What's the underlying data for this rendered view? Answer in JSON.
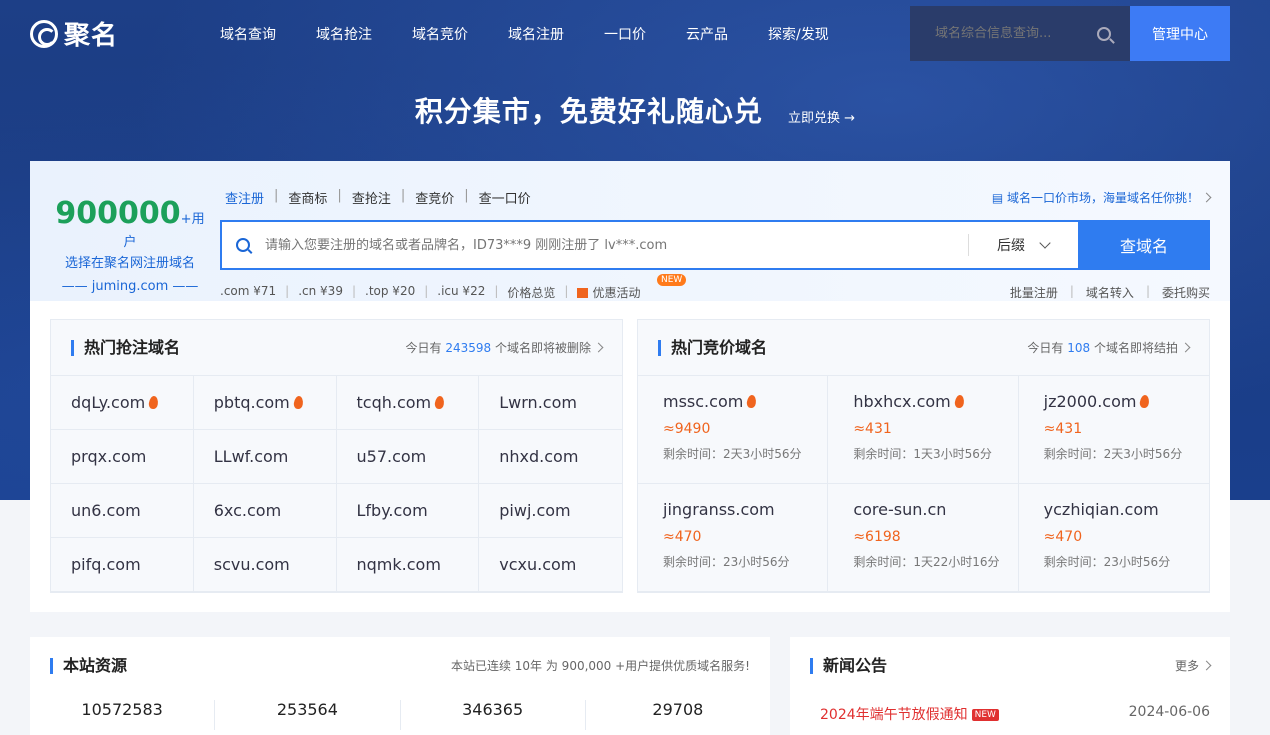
{
  "header": {
    "logo_text": "聚名",
    "nav": [
      "域名查询",
      "域名抢注",
      "域名竞价",
      "域名注册",
      "一口价",
      "云产品",
      "探索/发现"
    ],
    "search_placeholder": "域名综合信息查询...",
    "admin_label": "管理中心"
  },
  "banner": {
    "title": "积分集市，免费好礼随心兑",
    "link": "立即兑换 →"
  },
  "promo": {
    "number": "900000",
    "suffix": "+用户",
    "line2": "选择在聚名网注册域名",
    "line3": "—— juming.com ——"
  },
  "search": {
    "tabs": [
      "查注册",
      "查商标",
      "查抢注",
      "查竞价",
      "查一口价"
    ],
    "market_link": "域名一口价市场，海量域名任你挑！",
    "placeholder": "请输入您要注册的域名或者品牌名，ID73***9 刚刚注册了 lv***.com",
    "suffix_label": "后缀",
    "button": "查域名",
    "prices": [
      ".com ¥71",
      ".cn ¥39",
      ".top ¥20",
      ".icu ¥22",
      "价格总览"
    ],
    "promo_label": "优惠活动",
    "new_badge": "NEW",
    "actions": [
      "批量注册",
      "域名转入",
      "委托购买"
    ]
  },
  "hot_snatch": {
    "title": "热门抢注域名",
    "meta_prefix": "今日有",
    "meta_count": "243598",
    "meta_suffix": "个域名即将被删除",
    "domains": [
      {
        "name": "dqLy.com",
        "hot": true
      },
      {
        "name": "pbtq.com",
        "hot": true
      },
      {
        "name": "tcqh.com",
        "hot": true
      },
      {
        "name": "Lwrn.com",
        "hot": false
      },
      {
        "name": "prqx.com",
        "hot": false
      },
      {
        "name": "LLwf.com",
        "hot": false
      },
      {
        "name": "u57.com",
        "hot": false
      },
      {
        "name": "nhxd.com",
        "hot": false
      },
      {
        "name": "un6.com",
        "hot": false
      },
      {
        "name": "6xc.com",
        "hot": false
      },
      {
        "name": "Lfby.com",
        "hot": false
      },
      {
        "name": "piwj.com",
        "hot": false
      },
      {
        "name": "pifq.com",
        "hot": false
      },
      {
        "name": "scvu.com",
        "hot": false
      },
      {
        "name": "nqmk.com",
        "hot": false
      },
      {
        "name": "vcxu.com",
        "hot": false
      }
    ]
  },
  "hot_auction": {
    "title": "热门竞价域名",
    "meta_prefix": "今日有",
    "meta_count": "108",
    "meta_suffix": "个域名即将结拍",
    "items": [
      {
        "name": "mssc.com",
        "price": "≈9490",
        "time": "剩余时间：2天3小时56分",
        "hot": true
      },
      {
        "name": "hbxhcx.com",
        "price": "≈431",
        "time": "剩余时间：1天3小时56分",
        "hot": true
      },
      {
        "name": "jz2000.com",
        "price": "≈431",
        "time": "剩余时间：2天3小时56分",
        "hot": true
      },
      {
        "name": "jingranss.com",
        "price": "≈470",
        "time": "剩余时间：23小时56分",
        "hot": false
      },
      {
        "name": "core-sun.cn",
        "price": "≈6198",
        "time": "剩余时间：1天22小时16分",
        "hot": false
      },
      {
        "name": "yczhiqian.com",
        "price": "≈470",
        "time": "剩余时间：23小时56分",
        "hot": false
      }
    ]
  },
  "resources": {
    "title": "本站资源",
    "meta": "本站已连续 10年 为 900,000 +用户提供优质域名服务!",
    "stats": [
      "10572583",
      "253564",
      "346365",
      "29708"
    ]
  },
  "news": {
    "title": "新闻公告",
    "more": "更多",
    "items": [
      {
        "title": "2024年端午节放假通知",
        "badge": "NEW",
        "date": "2024-06-06"
      }
    ]
  },
  "colors": {
    "primary": "#2f7cf0",
    "accent": "#f0641e",
    "green": "#1ca05a",
    "banner_bg": "#1d3f87"
  }
}
